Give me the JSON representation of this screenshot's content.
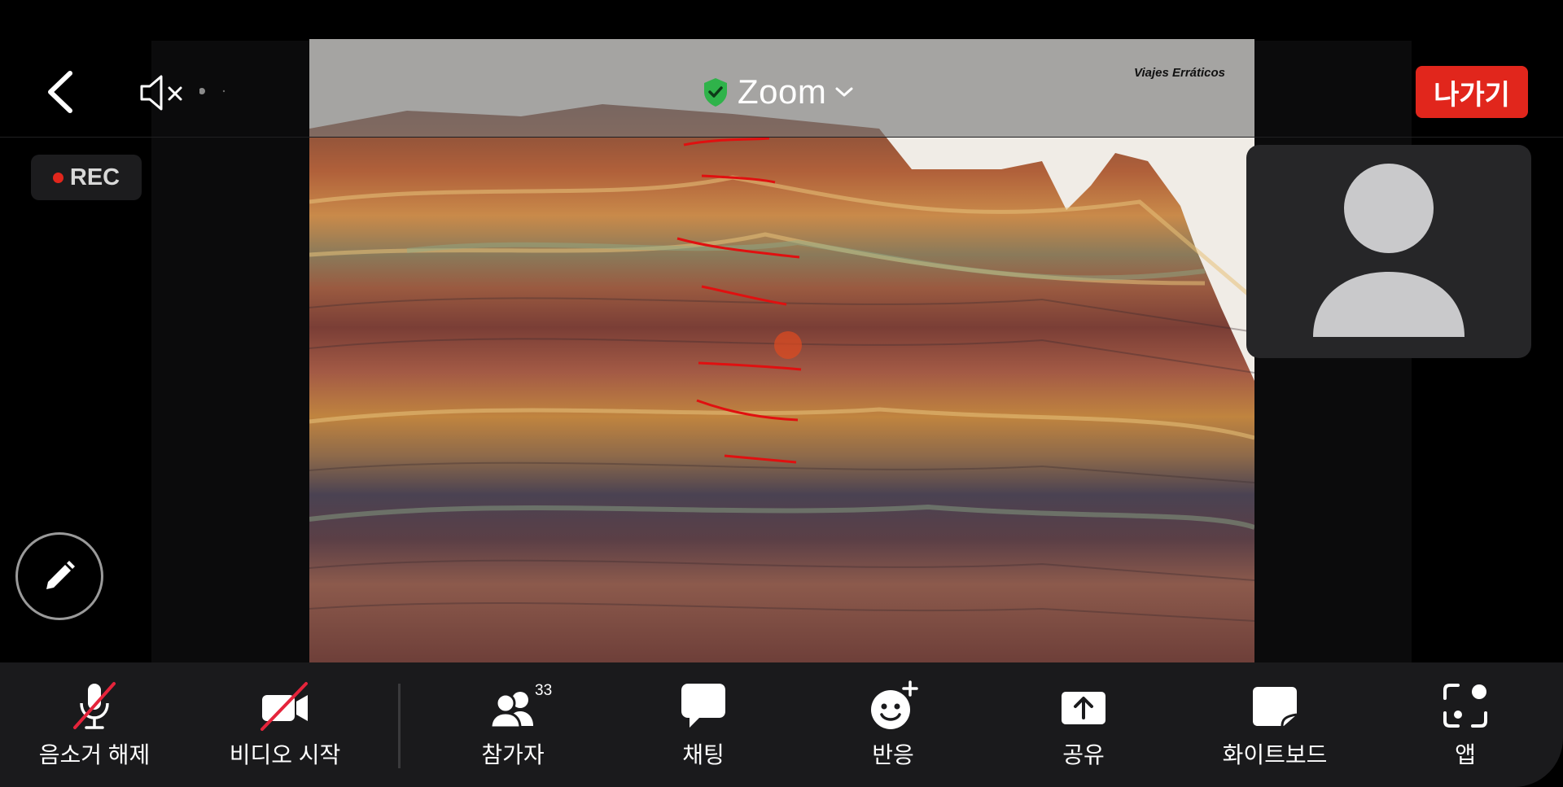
{
  "header": {
    "meeting_title": "Zoom",
    "leave_label": "나가기",
    "slide_watermark": "Viajes Erráticos"
  },
  "recording": {
    "label": "REC"
  },
  "toolbar": {
    "items": [
      {
        "key": "unmute",
        "label": "음소거 해제"
      },
      {
        "key": "start-video",
        "label": "비디오 시작"
      },
      {
        "key": "participants",
        "label": "참가자",
        "count": "33"
      },
      {
        "key": "chat",
        "label": "채팅"
      },
      {
        "key": "reactions",
        "label": "반응"
      },
      {
        "key": "share",
        "label": "공유"
      },
      {
        "key": "whiteboard",
        "label": "화이트보드"
      },
      {
        "key": "apps",
        "label": "앱"
      }
    ]
  },
  "colors": {
    "leave_button": "#e1261c",
    "secure_shield": "#2fb34a",
    "rec_dot": "#e1261c",
    "annotation_ink": "#e01010"
  },
  "icons": {
    "back": "chevron-left-icon",
    "speaker": "speaker-muted-icon",
    "title_dropdown": "chevron-down-icon",
    "annotate": "pencil-icon",
    "avatar": "person-silhouette-icon"
  }
}
